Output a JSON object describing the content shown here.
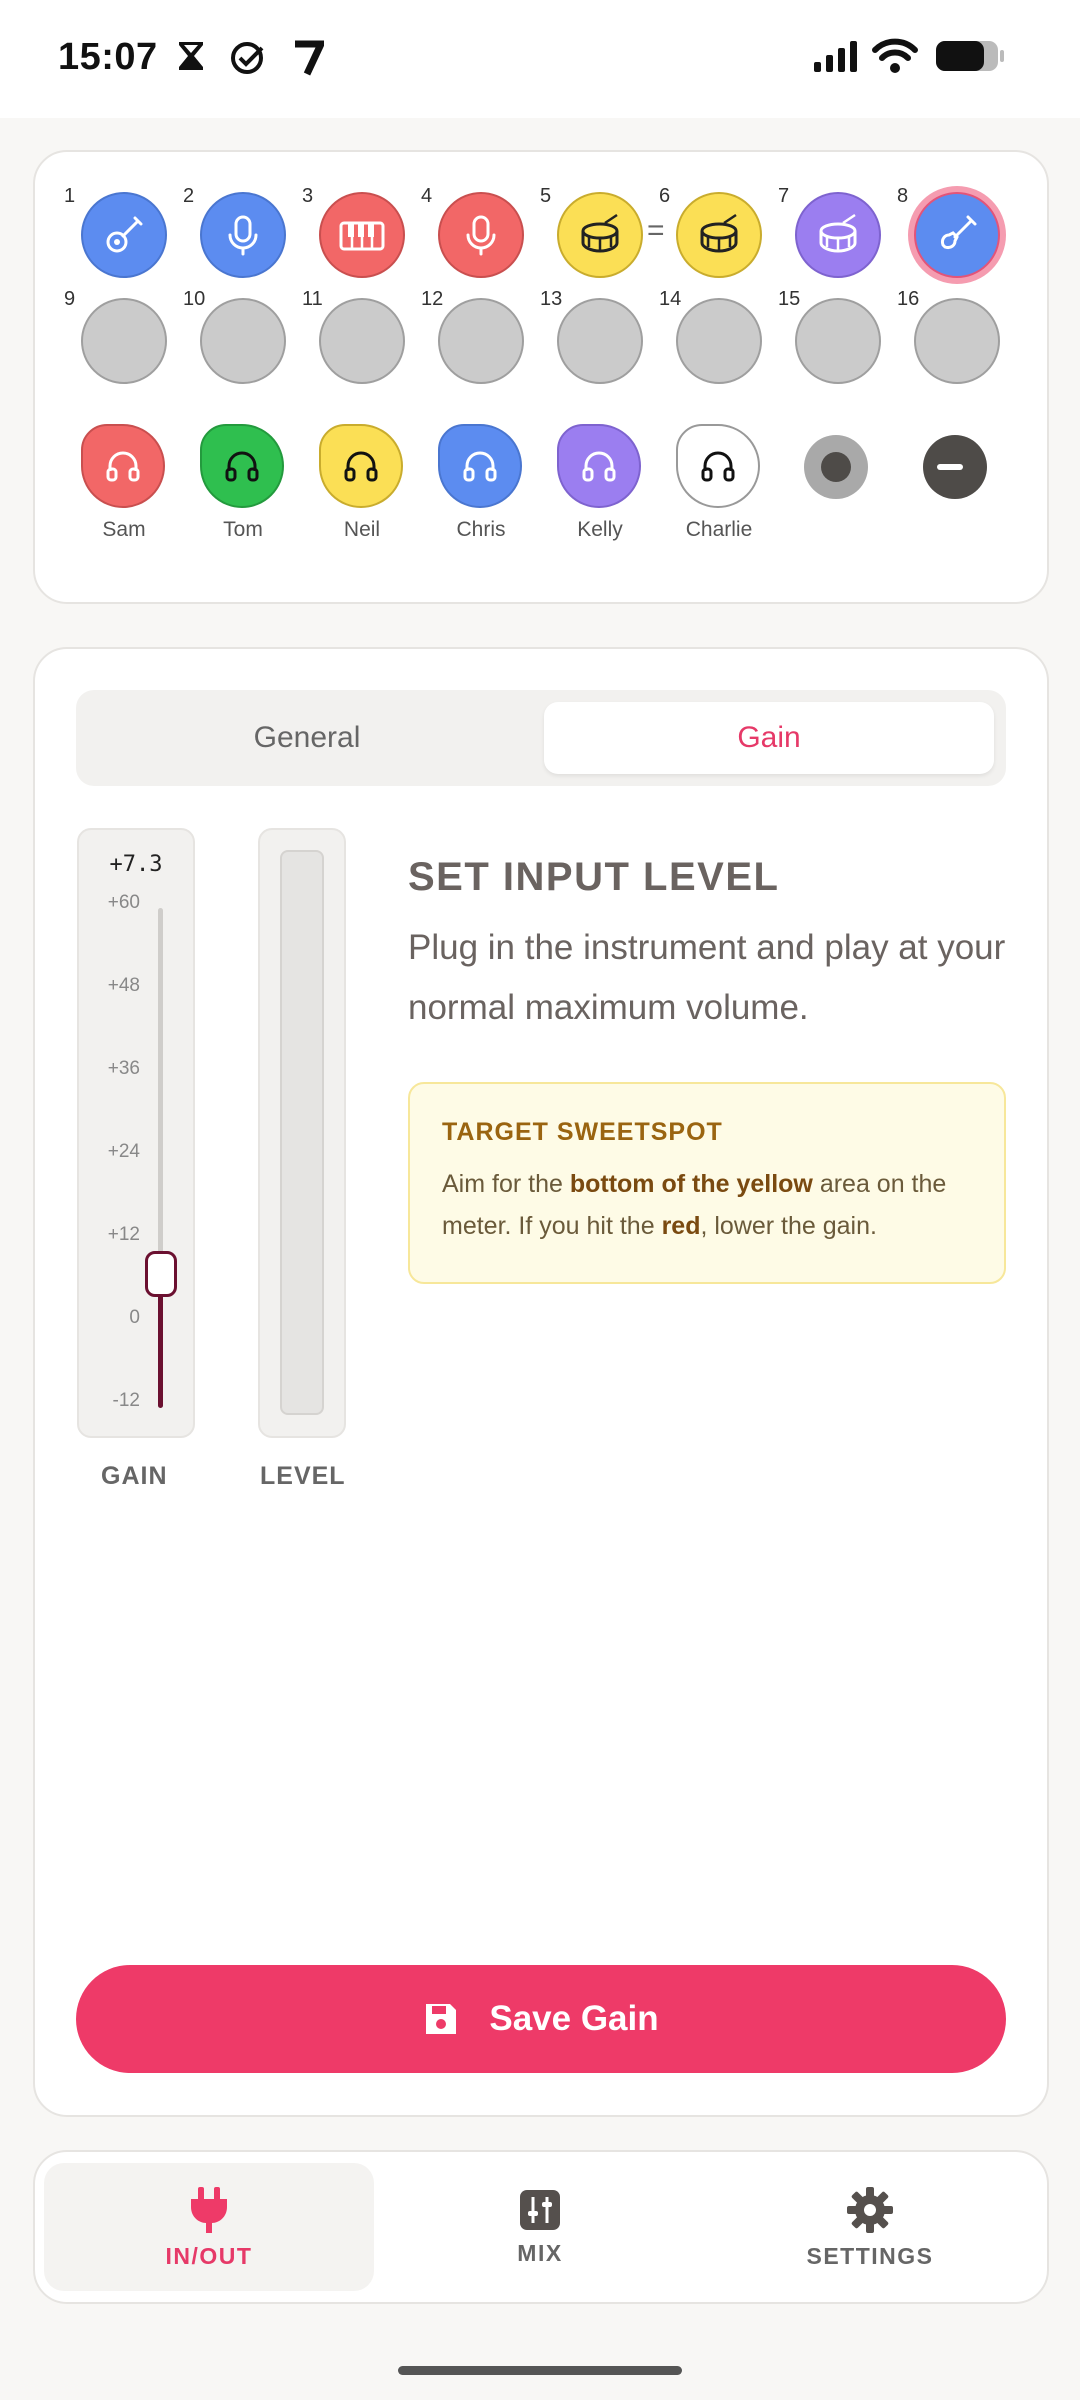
{
  "status_bar": {
    "time": "15:07",
    "left_icons": [
      "hourglass-icon",
      "check-circle-icon",
      "app-7-icon"
    ],
    "right_icons": [
      "signal-icon",
      "wifi-icon",
      "battery-icon"
    ]
  },
  "channels": [
    {
      "num": "1",
      "instrument": "acoustic-guitar-icon",
      "color": "#5c8cf0"
    },
    {
      "num": "2",
      "instrument": "microphone-icon",
      "color": "#5c8cf0"
    },
    {
      "num": "3",
      "instrument": "keyboard-icon",
      "color": "#f26767"
    },
    {
      "num": "4",
      "instrument": "microphone-icon",
      "color": "#f26767"
    },
    {
      "num": "5",
      "instrument": "drum-icon",
      "color": "#fbdf55"
    },
    {
      "num": "6",
      "instrument": "drum-icon",
      "color": "#fbdf55"
    },
    {
      "num": "7",
      "instrument": "drum-icon",
      "color": "#9b7ef0"
    },
    {
      "num": "8",
      "instrument": "electric-guitar-icon",
      "color": "#5c8cf0",
      "selected": true
    },
    {
      "num": "9"
    },
    {
      "num": "10"
    },
    {
      "num": "11"
    },
    {
      "num": "12"
    },
    {
      "num": "13"
    },
    {
      "num": "14"
    },
    {
      "num": "15"
    },
    {
      "num": "16"
    }
  ],
  "link_symbol": "=",
  "headphones": [
    {
      "name": "Sam",
      "color": "#f26767"
    },
    {
      "name": "Tom",
      "color": "#2fbf4f"
    },
    {
      "name": "Neil",
      "color": "#fbdf55"
    },
    {
      "name": "Chris",
      "color": "#5c8cf0"
    },
    {
      "name": "Kelly",
      "color": "#9b7ef0"
    },
    {
      "name": "Charlie",
      "color": "#ffffff"
    }
  ],
  "tabs": {
    "general": "General",
    "gain": "Gain",
    "active": "Gain"
  },
  "gain": {
    "value_label": "+7.3",
    "value": 7.3,
    "min": -12,
    "max": 60,
    "ticks": [
      "+60",
      "+48",
      "+36",
      "+24",
      "+12",
      "0",
      "-12"
    ],
    "label": "GAIN"
  },
  "level": {
    "label": "LEVEL",
    "value": 0
  },
  "instructions": {
    "title": "SET INPUT LEVEL",
    "body": "Plug in the instrument and play at your normal maximum volume."
  },
  "tip": {
    "title": "TARGET SWEETSPOT",
    "part1": "Aim for the ",
    "bold1": "bottom of the yellow",
    "part2": " area on the meter. If you hit the ",
    "bold2": "red",
    "part3": ", lower the gain."
  },
  "save_button": {
    "label": "Save Gain",
    "icon": "floppy-disk-icon"
  },
  "nav": [
    {
      "label": "IN/OUT",
      "icon": "plug-icon",
      "active": true
    },
    {
      "label": "MIX",
      "icon": "sliders-icon",
      "active": false
    },
    {
      "label": "SETTINGS",
      "icon": "gear-icon",
      "active": false
    }
  ],
  "colors": {
    "accent": "#ee3a68",
    "gain_track": "#6b1030"
  }
}
